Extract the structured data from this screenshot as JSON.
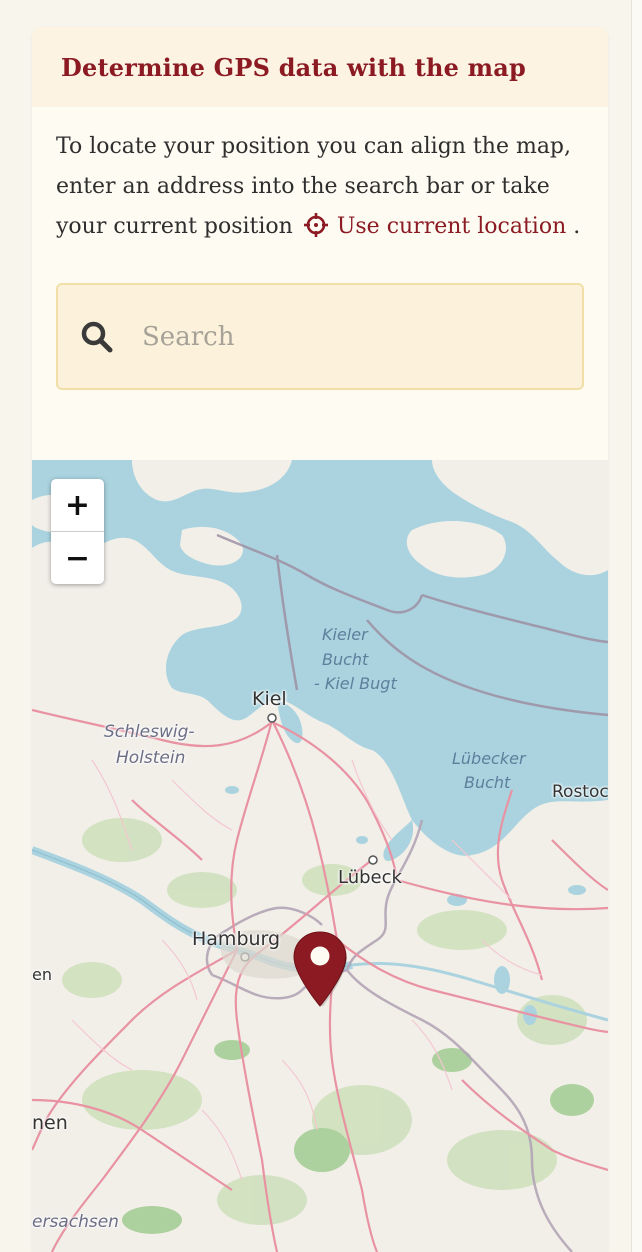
{
  "header": {
    "title": "Determine GPS data with the map"
  },
  "intro": {
    "text": "To locate your position you can align the map, enter an address into the search bar or take your current position",
    "location_link_label": "Use current location",
    "trailing": " ."
  },
  "search": {
    "placeholder": "Search",
    "value": ""
  },
  "map": {
    "zoom_in_label": "+",
    "zoom_out_label": "−",
    "labels": {
      "kieler_bucht_1": "Kieler",
      "kieler_bucht_2": "Bucht",
      "kieler_bucht_3": "- Kiel Bugt",
      "kiel": "Kiel",
      "schleswig": "Schleswig-",
      "holstein": "Holstein",
      "luebecker": "Lübecker",
      "bucht": "Bucht",
      "rostock": "Rostoc",
      "luebeck": "Lübeck",
      "hamburg": "Hamburg",
      "en": "en",
      "nen": "nen",
      "ersachsen": "ersachsen"
    },
    "marker_icon": "map-pin-icon",
    "colors": {
      "water": "#aad3df",
      "land": "#f2efe9",
      "forest": "#add19e",
      "road": "#e892a2",
      "border": "#9e8fa4",
      "marker": "#8b1a22"
    }
  },
  "colors": {
    "accent": "#8b1a22",
    "header_bg": "#fcf3e3",
    "search_bg": "#fcf1da",
    "search_border": "#f2dfa8"
  }
}
